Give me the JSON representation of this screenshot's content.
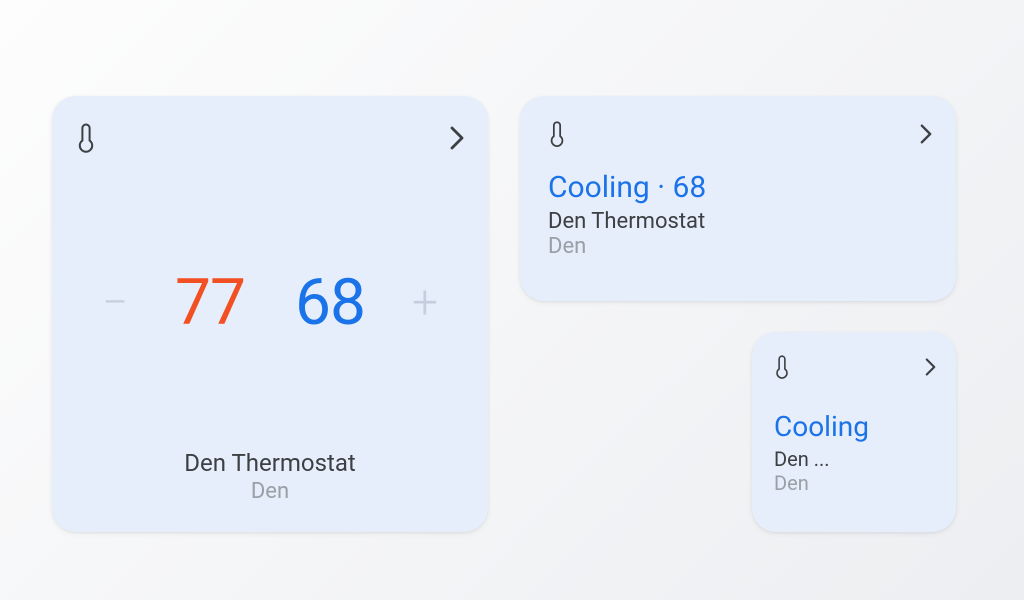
{
  "colors": {
    "card_bg": "#e6edfb",
    "heat": "#f25022",
    "cool": "#1a73e8",
    "text_primary": "#3c4043",
    "text_secondary": "#9aa0a6"
  },
  "large_card": {
    "heat_setpoint": "77",
    "cool_setpoint": "68",
    "device_name": "Den Thermostat",
    "room": "Den",
    "minus_label": "−",
    "plus_label": "+"
  },
  "medium_card": {
    "status_line": "Cooling · 68",
    "device_name": "Den Thermostat",
    "room": "Den"
  },
  "small_card": {
    "status_line": "Cooling",
    "device_name_truncated": "Den ...",
    "room": "Den"
  }
}
